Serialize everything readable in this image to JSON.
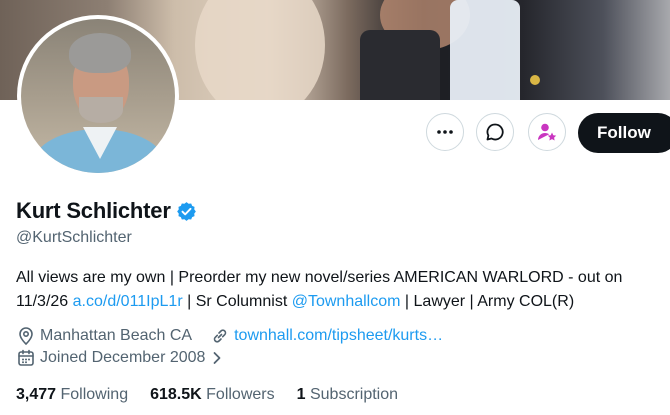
{
  "profile": {
    "display_name": "Kurt Schlichter",
    "handle": "@KurtSchlichter",
    "verified_icon": "verified-badge-icon",
    "bio": {
      "part1": "All views are my own | Preorder my new novel/series AMERICAN WARLORD - out on 11/3/26 ",
      "link1": "a.co/d/011IpL1r",
      "part2": " | Sr Columnist ",
      "mention": "@Townhallcom",
      "part3": " | Lawyer | Army COL(R)"
    },
    "location": "Manhattan Beach CA",
    "website": "townhall.com/tipsheet/kurts…",
    "joined": "Joined December 2008"
  },
  "actions": {
    "more_icon": "more-icon",
    "message_icon": "message-icon",
    "subscribe_icon": "subscribe-icon",
    "follow_label": "Follow"
  },
  "stats": {
    "following_count": "3,477",
    "following_label": "Following",
    "followers_count": "618.5K",
    "followers_label": "Followers",
    "subscriptions_count": "1",
    "subscriptions_label": "Subscription"
  },
  "colors": {
    "accent": "#1d9bf0",
    "text": "#0f1419",
    "muted": "#536471",
    "subscribe": "#c936c0"
  }
}
